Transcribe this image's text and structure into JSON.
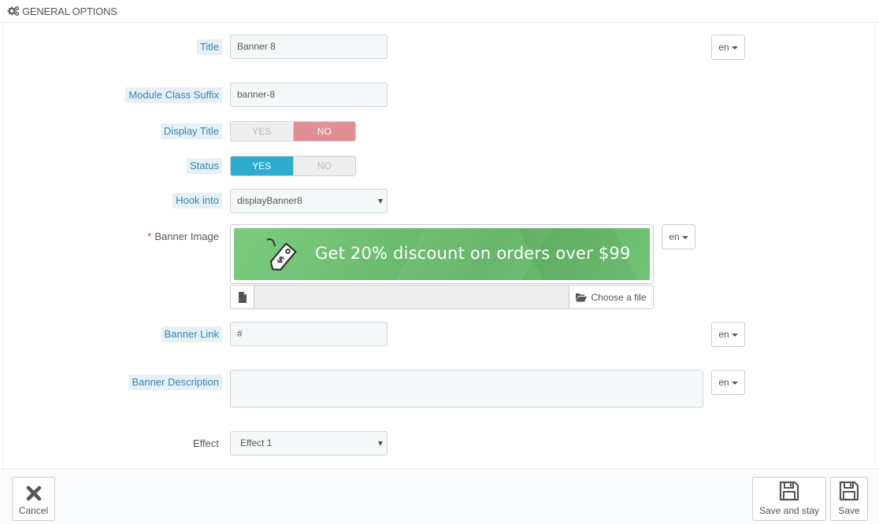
{
  "panel": {
    "heading": "GENERAL OPTIONS",
    "heading_icon": "cogs-icon"
  },
  "form": {
    "title": {
      "label": "Title",
      "value": "Banner 8",
      "lang": "en"
    },
    "module_class_suffix": {
      "label": "Module Class Suffix",
      "value": "banner-8"
    },
    "display_title": {
      "label": "Display Title",
      "yes": "YES",
      "no": "NO",
      "selected": "NO"
    },
    "status": {
      "label": "Status",
      "yes": "YES",
      "no": "NO",
      "selected": "YES"
    },
    "hook_into": {
      "label": "Hook into",
      "value": "displayBanner8"
    },
    "banner_image": {
      "required_mark": "*",
      "label": "Banner Image",
      "lang": "en",
      "preview_text": "Get 20% discount on orders over $99",
      "preview_icon": "price-tag-icon",
      "choose_label": "Choose a file",
      "file_name": ""
    },
    "banner_link": {
      "label": "Banner Link",
      "value": "#",
      "lang": "en"
    },
    "banner_description": {
      "label": "Banner Description",
      "value": "",
      "lang": "en"
    },
    "effect": {
      "label": "Effect",
      "value": "Effect 1"
    }
  },
  "footer": {
    "cancel_label": "Cancel",
    "save_and_stay_label": "Save and stay",
    "save_label": "Save"
  },
  "colors": {
    "label_blue": "#3586ae",
    "label_bg": "#e7f0f6",
    "switch_yes": "#2eacce",
    "switch_no": "#e08f95",
    "banner_green": "#6ebe71"
  }
}
